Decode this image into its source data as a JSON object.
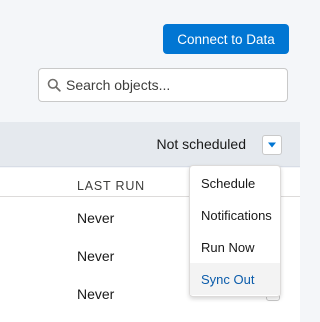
{
  "header": {
    "connect_button": "Connect to Data"
  },
  "search": {
    "placeholder": "Search objects...",
    "icon": "search-icon"
  },
  "status": {
    "text": "Not scheduled",
    "trigger_icon": "chevron-down-icon"
  },
  "table": {
    "columns": [
      "LAST RUN"
    ],
    "rows": [
      {
        "last_run": "Never"
      },
      {
        "last_run": "Never"
      },
      {
        "last_run": "Never"
      }
    ]
  },
  "menu": {
    "items": [
      {
        "label": "Schedule"
      },
      {
        "label": "Notifications"
      },
      {
        "label": "Run Now"
      },
      {
        "label": "Sync Out"
      }
    ],
    "active_item": "Sync Out"
  },
  "colors": {
    "primary": "#0176d3",
    "active_text": "#0b5cab",
    "status_bar": "#e5e9ee"
  }
}
